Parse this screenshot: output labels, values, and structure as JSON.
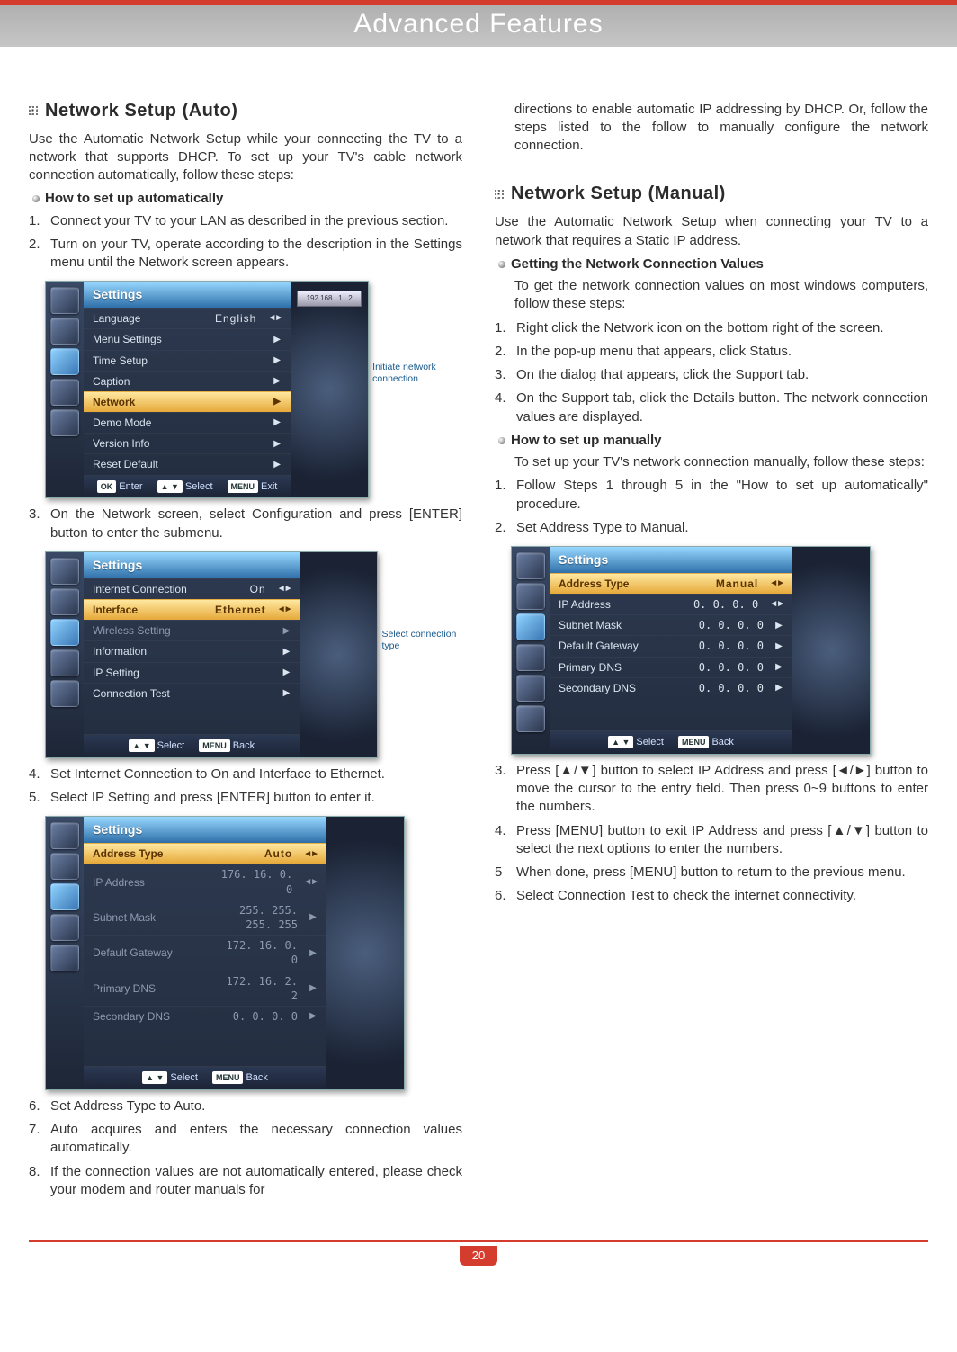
{
  "page": {
    "banner": "Advanced Features",
    "page_number": "20"
  },
  "left": {
    "h_auto": "Network Setup (Auto)",
    "p_intro": "Use the Automatic Network Setup while your connecting the TV to a network that supports DHCP. To set up your TV's cable network connection automatically, follow these steps:",
    "sub_howauto": "How to set up automatically",
    "s1": "Connect your TV to your LAN as described in the previous section.",
    "s2": "Turn on your TV, operate according to the description in the Settings menu until the Network screen appears.",
    "s3": "On the Network screen, select Configuration and press [ENTER] button to enter the submenu.",
    "s4": "Set Internet Connection to On and Interface to Ethernet.",
    "s5": "Select IP Setting and press [ENTER] button to enter it.",
    "s6": "Set Address Type to Auto.",
    "s7": "Auto acquires and enters the necessary connection values automatically.",
    "s8": "If the connection values are not automatically entered, please check your modem and router manuals for",
    "osd1_ann": "Initiate network connection",
    "osd2_ann": "Select connection type"
  },
  "right": {
    "p_cont": "directions to enable automatic IP addressing by DHCP. Or, follow the steps listed to the follow to manually configure the network connection.",
    "h_manual": "Network Setup (Manual)",
    "p_manual_intro": "Use the Automatic Network Setup when connecting your TV to a network that requires a Static IP address.",
    "sub_getval": "Getting the Network Connection Values",
    "p_getval": "To get the network connection values on most windows computers, follow these steps:",
    "m1": "Right click the Network icon on the bottom right of the screen.",
    "m2": "In the pop-up menu that appears, click Status.",
    "m3": "On the dialog that appears, click the Support tab.",
    "m4": "On the Support tab, click the Details button. The network connection values are displayed.",
    "sub_howman": "How to set up manually",
    "p_howman": "To set up your TV's network connection manually, follow these steps:",
    "n1": "Follow Steps 1 through 5 in the \"How to set up automatically\" procedure.",
    "n2": "Set Address Type to Manual.",
    "n3": "Press [▲/▼] button to select IP Address and press [◄/►] button to move the cursor to the entry field. Then press 0~9 buttons to enter the numbers.",
    "n4": "Press [MENU] button to exit IP Address and press [▲/▼] button to select the next options to enter the numbers.",
    "n5": "When done, press [MENU] button to return to the previous menu.",
    "n6": "Select Connection Test to check the internet connectivity."
  },
  "osd1": {
    "title": "Settings",
    "items": [
      {
        "lab": "Language",
        "val": "English",
        "lr": true
      },
      {
        "lab": "Menu Settings",
        "arrow": true
      },
      {
        "lab": "Time Setup",
        "arrow": true
      },
      {
        "lab": "Caption",
        "arrow": true
      },
      {
        "lab": "Network",
        "arrow": true,
        "hl": true
      },
      {
        "lab": "Demo Mode",
        "arrow": true
      },
      {
        "lab": "Version Info",
        "arrow": true
      },
      {
        "lab": "Reset Default",
        "arrow": true
      }
    ],
    "foot": {
      "ok": "Enter",
      "sel": "Select",
      "menu": "Exit"
    },
    "preview": "192.168 . 1 . 2"
  },
  "osd2": {
    "title": "Settings",
    "items": [
      {
        "lab": "Internet Connection",
        "val": "On",
        "lr": true
      },
      {
        "lab": "Interface",
        "val": "Ethernet",
        "lr": true,
        "hl": true
      },
      {
        "lab": "Wireless Setting",
        "arrow": true,
        "dim": true
      },
      {
        "lab": "Information",
        "arrow": true
      },
      {
        "lab": "IP Setting",
        "arrow": true
      },
      {
        "lab": "Connection Test",
        "arrow": true
      }
    ],
    "foot": {
      "sel": "Select",
      "menu": "Back"
    }
  },
  "osd3": {
    "title": "Settings",
    "items": [
      {
        "lab": "Address Type",
        "val": "Auto",
        "lr": true,
        "hl": true
      },
      {
        "lab": "IP Address",
        "val": "176.   16.    0.    0",
        "lr": true,
        "dim": true
      },
      {
        "lab": "Subnet Mask",
        "val": "255.  255.  255.  255",
        "arrow": true,
        "dim": true
      },
      {
        "lab": "Default Gateway",
        "val": "172.   16.   0.   0",
        "arrow": true,
        "dim": true
      },
      {
        "lab": "Primary DNS",
        "val": "172.   16.   2.   2",
        "arrow": true,
        "dim": true
      },
      {
        "lab": "Secondary DNS",
        "val": "0.    0.    0.    0",
        "arrow": true,
        "dim": true
      }
    ],
    "foot": {
      "sel": "Select",
      "menu": "Back"
    }
  },
  "osd4": {
    "title": "Settings",
    "items": [
      {
        "lab": "Address Type",
        "val": "Manual",
        "lr": true,
        "hl": true
      },
      {
        "lab": "IP Address",
        "val": "0.    0.    0.    0",
        "lr": true
      },
      {
        "lab": "Subnet Mask",
        "val": "0.    0.    0.    0",
        "arrow": true
      },
      {
        "lab": "Default Gateway",
        "val": "0.    0.    0.    0",
        "arrow": true
      },
      {
        "lab": "Primary DNS",
        "val": "0.    0.    0.    0",
        "arrow": true
      },
      {
        "lab": "Secondary DNS",
        "val": "0.    0.    0.    0",
        "arrow": true
      }
    ],
    "foot": {
      "sel": "Select",
      "menu": "Back"
    }
  },
  "keys": {
    "ok": "OK",
    "ud": "▲ ▼",
    "menu": "MENU"
  }
}
